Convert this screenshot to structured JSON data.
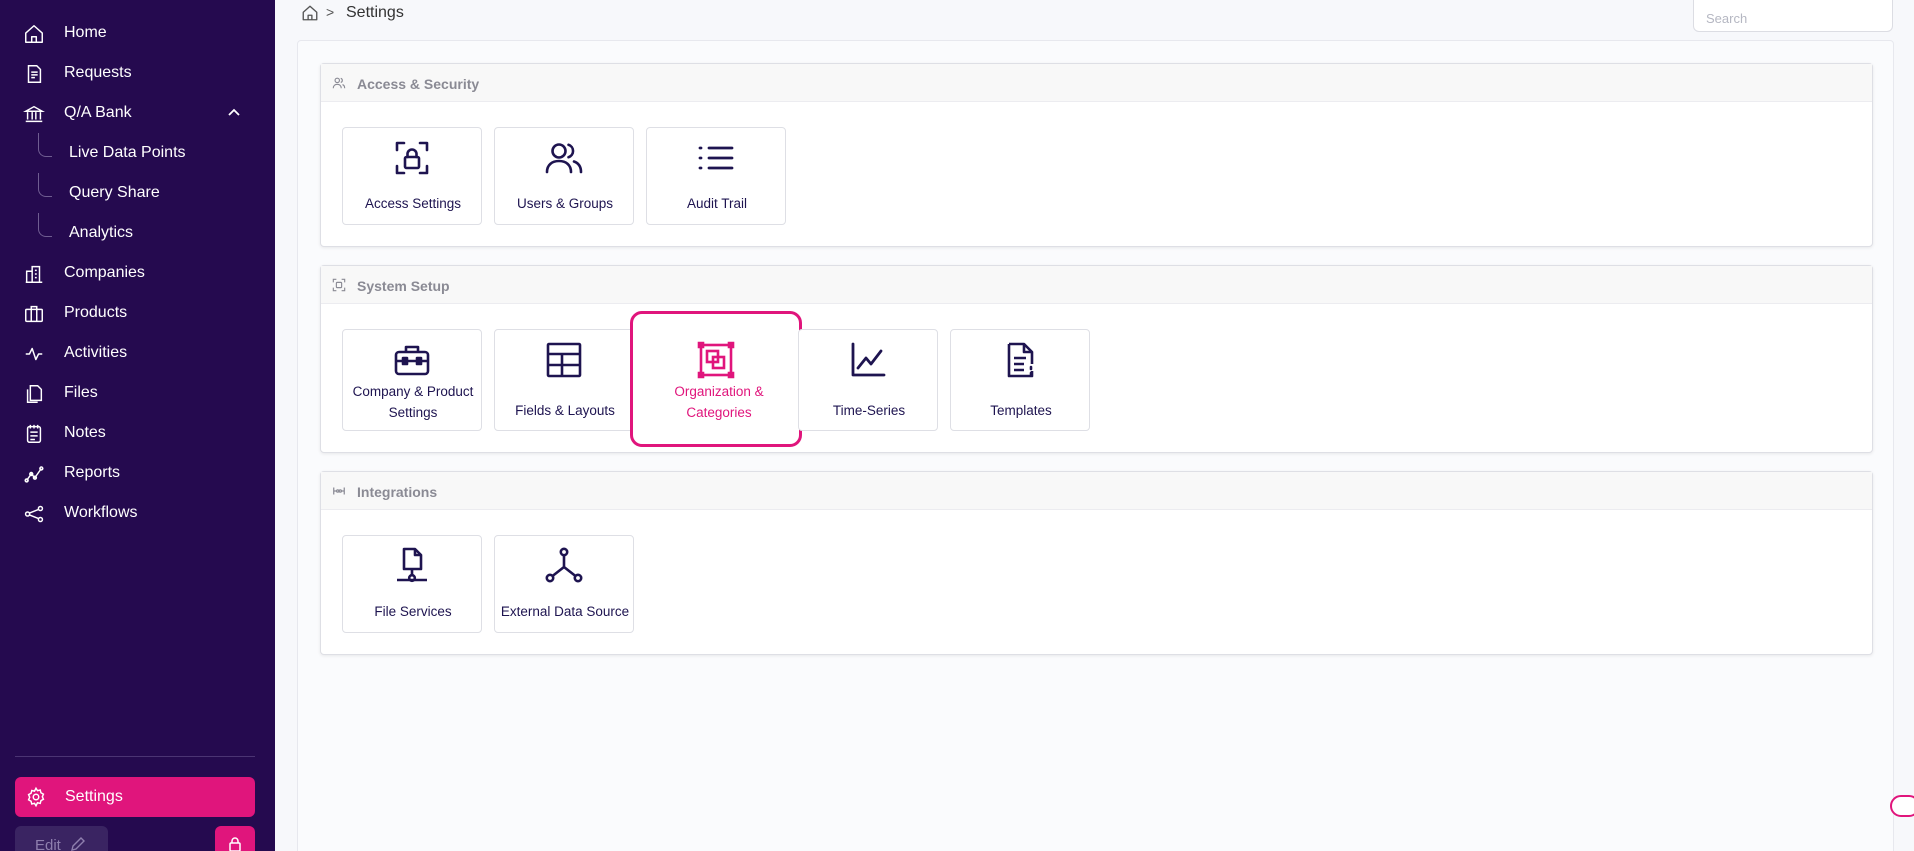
{
  "sidebar": {
    "items": [
      {
        "label": "Home",
        "icon": "home-icon"
      },
      {
        "label": "Requests",
        "icon": "document-icon"
      },
      {
        "label": "Q/A Bank",
        "icon": "bank-icon"
      },
      {
        "label": "Companies",
        "icon": "buildings-icon"
      },
      {
        "label": "Products",
        "icon": "package-icon"
      },
      {
        "label": "Activities",
        "icon": "activity-icon"
      },
      {
        "label": "Files",
        "icon": "files-icon"
      },
      {
        "label": "Notes",
        "icon": "notes-icon"
      },
      {
        "label": "Reports",
        "icon": "reports-icon"
      },
      {
        "label": "Workflows",
        "icon": "workflow-icon"
      }
    ],
    "qa_bank_children": [
      "Live Data Points",
      "Query Share",
      "Analytics"
    ],
    "settings_label": "Settings",
    "edit_label": "Edit"
  },
  "breadcrumb": {
    "current": "Settings",
    "separator": ">"
  },
  "search": {
    "placeholder": "Search"
  },
  "sections": [
    {
      "title": "Access & Security",
      "icon": "people-icon",
      "cards": [
        {
          "label": "Access Settings",
          "icon": "lock-frame-icon"
        },
        {
          "label": "Users & Groups",
          "icon": "users-icon"
        },
        {
          "label": "Audit Trail",
          "icon": "list-icon"
        }
      ]
    },
    {
      "title": "System Setup",
      "icon": "scan-icon",
      "cards": [
        {
          "label": "Company & Product Settings",
          "label_line1": "Company & Product",
          "label_line2": "Settings",
          "icon": "briefcase-icon"
        },
        {
          "label": "Fields & Layouts",
          "icon": "table-icon"
        },
        {
          "label": "Organization & Categories",
          "label_line1": "Organization &",
          "label_line2": "Categories",
          "icon": "organize-icon",
          "selected": true
        },
        {
          "label": "Time-Series",
          "icon": "line-chart-icon"
        },
        {
          "label": "Templates",
          "icon": "template-icon"
        }
      ]
    },
    {
      "title": "Integrations",
      "icon": "connector-icon",
      "cards": [
        {
          "label": "File Services",
          "icon": "file-service-icon"
        },
        {
          "label": "External Data Source",
          "icon": "network-icon"
        }
      ]
    }
  ],
  "colors": {
    "sidebar_bg": "#250a4f",
    "accent": "#e0157c",
    "icon_dark": "#1e1450"
  }
}
